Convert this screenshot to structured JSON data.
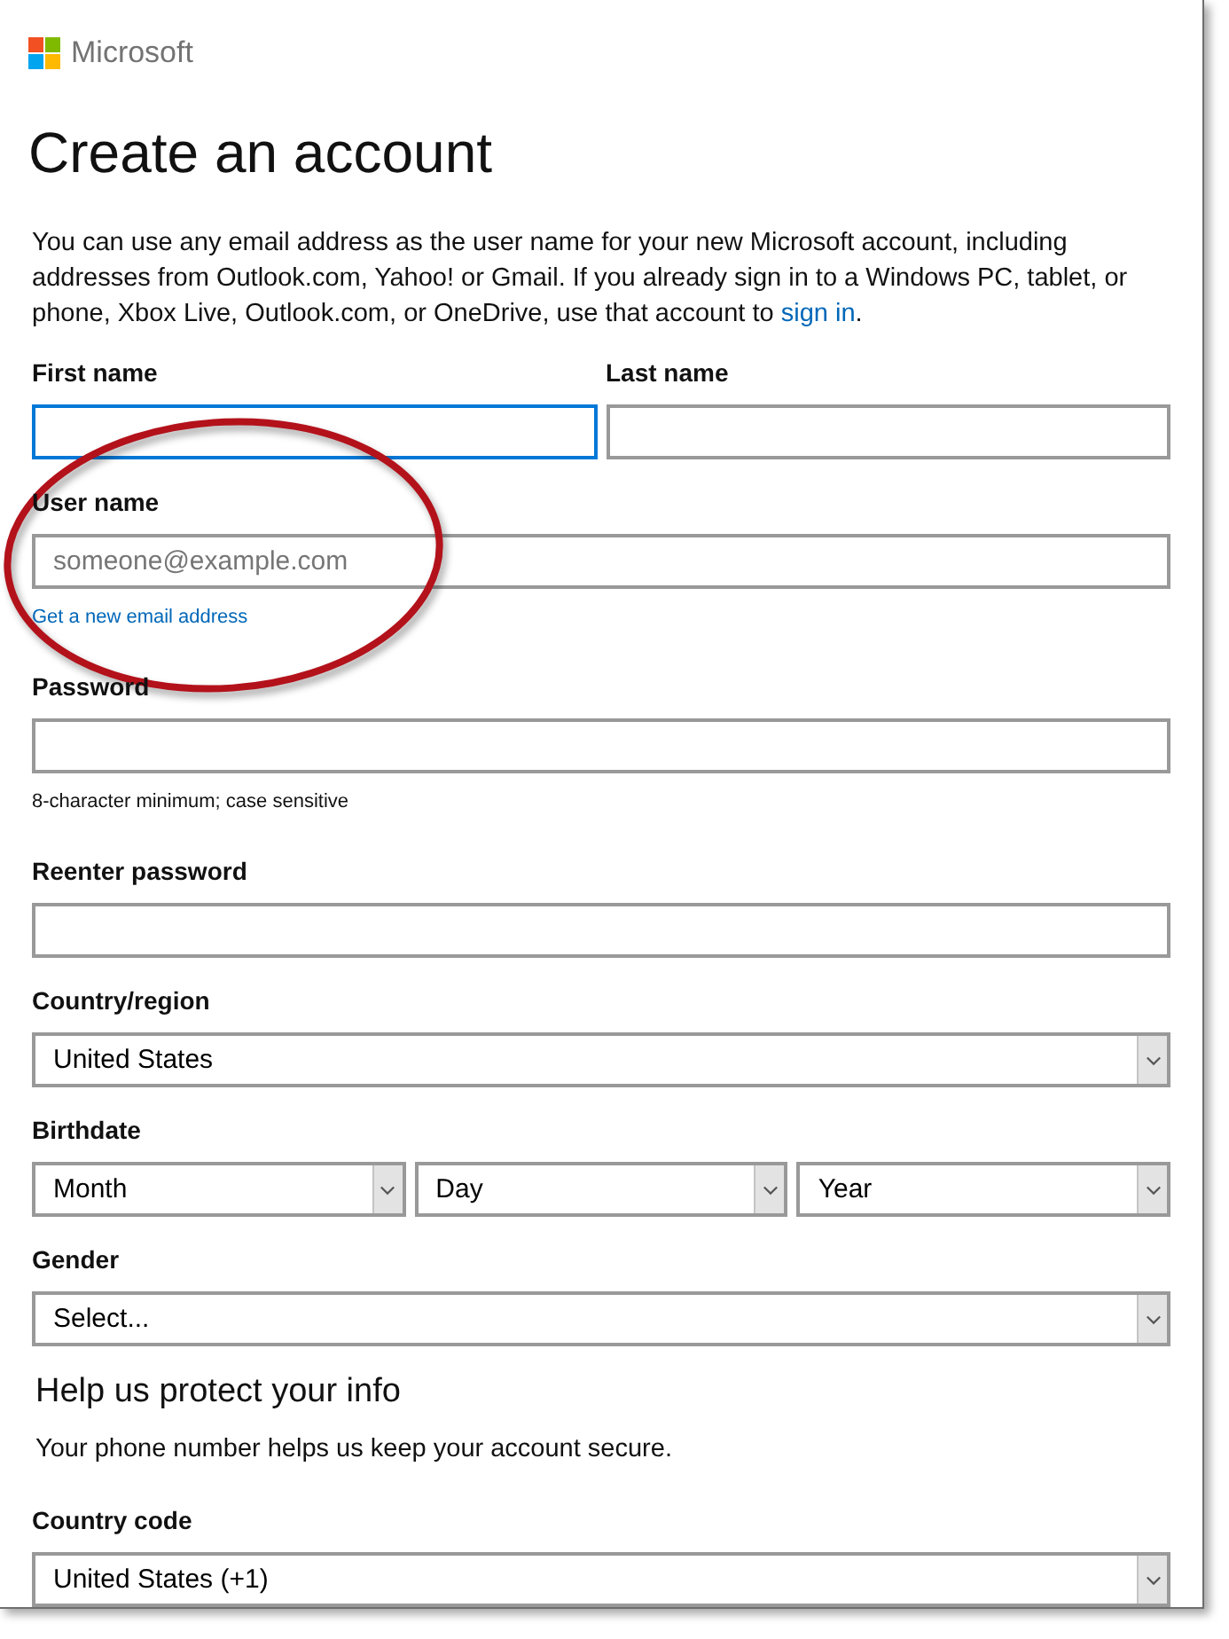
{
  "header": {
    "logo_text": "Microsoft"
  },
  "title": "Create an account",
  "intro": {
    "text": "You can use any email address as the user name for your new Microsoft account, including addresses from Outlook.com, Yahoo! or Gmail. If you already sign in to a Windows PC, tablet, or phone, Xbox Live, Outlook.com, or OneDrive, use that account to ",
    "link": "sign in",
    "end": "."
  },
  "fields": [
    {
      "kind": "pair",
      "items": [
        {
          "label": "First name",
          "focused": true
        },
        {
          "label": "Last name",
          "focused": false
        }
      ]
    },
    {
      "kind": "text",
      "label": "User name",
      "placeholder": "someone@example.com",
      "link": "Get a new email address",
      "focused": false
    },
    {
      "kind": "text",
      "label": "Password",
      "hint": "8-character minimum; case sensitive",
      "focused": false
    },
    {
      "kind": "text",
      "label": "Reenter password",
      "focused": false
    },
    {
      "kind": "select",
      "label": "Country/region",
      "value": "United States",
      "focused": false
    },
    {
      "kind": "select-group",
      "label": "Birthdate",
      "selects": [
        {
          "value": "Month",
          "focused": false
        },
        {
          "value": "Day",
          "focused": false
        },
        {
          "value": "Year",
          "focused": false
        }
      ]
    },
    {
      "kind": "select",
      "label": "Gender",
      "value": "Select...",
      "focused": false
    },
    {
      "kind": "section",
      "heading": "Help us protect your info",
      "text": "Your phone number helps us keep your account secure."
    },
    {
      "kind": "select",
      "label": "Country code",
      "value": "United States (+1)",
      "focused": false
    }
  ],
  "annotation": {
    "kind": "ellipse"
  }
}
